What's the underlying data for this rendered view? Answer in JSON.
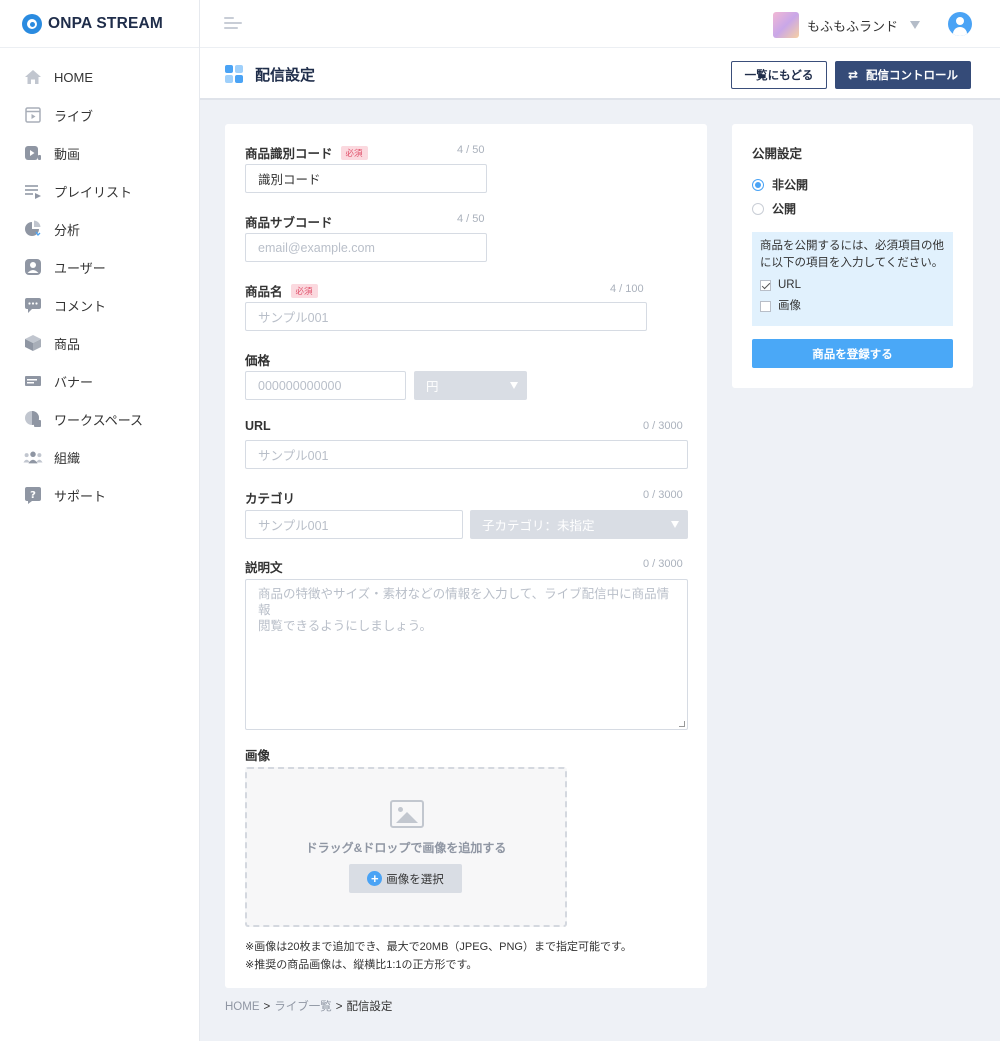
{
  "app": {
    "logo_text": "ONPA STREAM"
  },
  "sidebar": {
    "items": [
      {
        "label": "HOME",
        "icon": "home-icon"
      },
      {
        "label": "ライブ",
        "icon": "live-icon"
      },
      {
        "label": "動画",
        "icon": "video-icon"
      },
      {
        "label": "プレイリスト",
        "icon": "playlist-icon"
      },
      {
        "label": "分析",
        "icon": "analytics-icon"
      },
      {
        "label": "ユーザー",
        "icon": "user-icon"
      },
      {
        "label": "コメント",
        "icon": "comment-icon"
      },
      {
        "label": "商品",
        "icon": "product-icon"
      },
      {
        "label": "バナー",
        "icon": "banner-icon"
      },
      {
        "label": "ワークスペース",
        "icon": "workspace-icon"
      },
      {
        "label": "組織",
        "icon": "organization-icon"
      },
      {
        "label": "サポート",
        "icon": "support-icon"
      }
    ]
  },
  "header": {
    "account_name": "もふもふランド"
  },
  "page": {
    "title": "配信設定",
    "back_label": "一覧にもどる",
    "control_label": "配信コントロール"
  },
  "form": {
    "code": {
      "label": "商品識別コード",
      "required": "必須",
      "counter": "4 / 50",
      "value": "識別コード"
    },
    "subcode": {
      "label": "商品サブコード",
      "counter": "4 / 50",
      "placeholder": "email@example.com"
    },
    "name": {
      "label": "商品名",
      "required": "必須",
      "counter": "4 / 100",
      "placeholder": "サンプル001"
    },
    "price": {
      "label": "価格",
      "placeholder": "000000000000",
      "currency": "円"
    },
    "url": {
      "label": "URL",
      "counter": "0 / 3000",
      "placeholder": "サンプル001"
    },
    "category": {
      "label": "カテゴリ",
      "counter": "0 / 3000",
      "placeholder": "サンプル001",
      "subcategory": "子カテゴリ：未指定"
    },
    "description": {
      "label": "説明文",
      "counter": "0 / 3000",
      "placeholder_line1": "商品の特徴やサイズ・素材などの情報を入力して、ライブ配信中に商品情報",
      "placeholder_line2": "閲覧できるようにしましょう。"
    },
    "image": {
      "label": "画像",
      "drop_text": "ドラッグ&ドロップで画像を追加する",
      "select_label": "画像を選択",
      "note1": "※画像は20枚まで追加でき、最大で20MB（JPEG、PNG）まで指定可能です。",
      "note2": "※推奨の商品画像は、縦横比1:1の正方形です。"
    }
  },
  "publish": {
    "title": "公開設定",
    "options": [
      "非公開",
      "公開"
    ],
    "selected": "非公開",
    "info_line1": "商品を公開するには、必須項目の他",
    "info_line2": "に以下の項目を入力してください。",
    "checks": [
      {
        "label": "URL",
        "checked": true
      },
      {
        "label": "画像",
        "checked": false
      }
    ],
    "register_label": "商品を登録する"
  },
  "breadcrumb": {
    "items": [
      "HOME",
      "ライブ一覧",
      "配信設定"
    ],
    "separator": ">"
  },
  "colors": {
    "accent": "#4aa3f5",
    "navy": "#354b78",
    "required": "#e0506a"
  }
}
